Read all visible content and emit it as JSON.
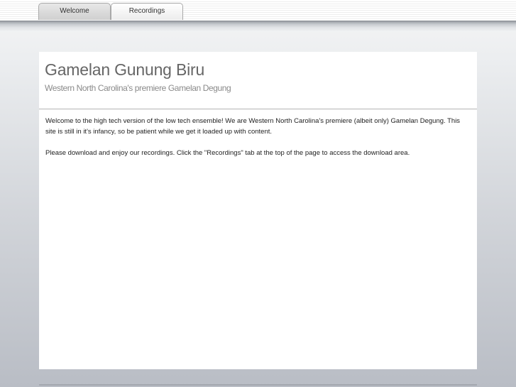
{
  "nav": {
    "tabs": [
      {
        "label": "Welcome",
        "active": true
      },
      {
        "label": "Recordings",
        "active": false
      }
    ]
  },
  "header": {
    "title": "Gamelan Gunung Biru",
    "subtitle": "Western North Carolina's premiere Gamelan Degung"
  },
  "main": {
    "paragraphs": [
      "Welcome to the high tech version of the low tech ensemble! We are Western North Carolina's premiere (albeit only) Gamelan Degung. This site is still in it's infancy, so be patient while we get it loaded up with content.",
      "Please download and enjoy our recordings. Click the \"Recordings\" tab at the top of the page to access the download area."
    ]
  }
}
